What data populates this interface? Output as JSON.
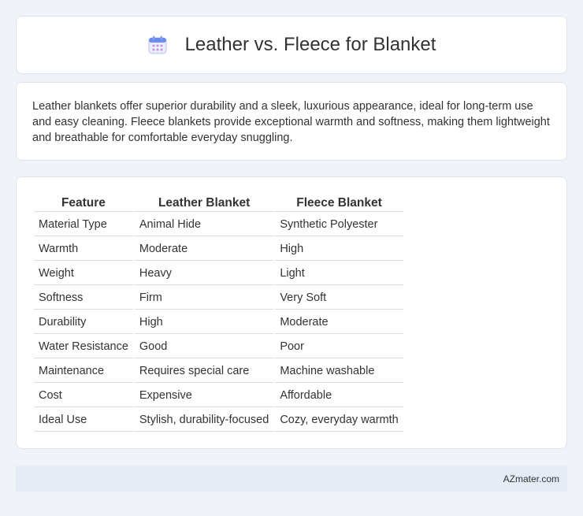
{
  "header": {
    "title": "Leather vs. Fleece for Blanket",
    "icon": "calendar-icon"
  },
  "description": "Leather blankets offer superior durability and a sleek, luxurious appearance, ideal for long-term use and easy cleaning. Fleece blankets provide exceptional warmth and softness, making them lightweight and breathable for comfortable everyday snuggling.",
  "table": {
    "headers": [
      "Feature",
      "Leather Blanket",
      "Fleece Blanket"
    ],
    "rows": [
      [
        "Material Type",
        "Animal Hide",
        "Synthetic Polyester"
      ],
      [
        "Warmth",
        "Moderate",
        "High"
      ],
      [
        "Weight",
        "Heavy",
        "Light"
      ],
      [
        "Softness",
        "Firm",
        "Very Soft"
      ],
      [
        "Durability",
        "High",
        "Moderate"
      ],
      [
        "Water Resistance",
        "Good",
        "Poor"
      ],
      [
        "Maintenance",
        "Requires special care",
        "Machine washable"
      ],
      [
        "Cost",
        "Expensive",
        "Affordable"
      ],
      [
        "Ideal Use",
        "Stylish, durability-focused",
        "Cozy, everyday warmth"
      ]
    ]
  },
  "footer": {
    "site": "AZmater.com"
  },
  "colors": {
    "background": "#f0f3f8",
    "footer_bg": "#e6ecf6",
    "icon_accent": "#6b8cef"
  }
}
